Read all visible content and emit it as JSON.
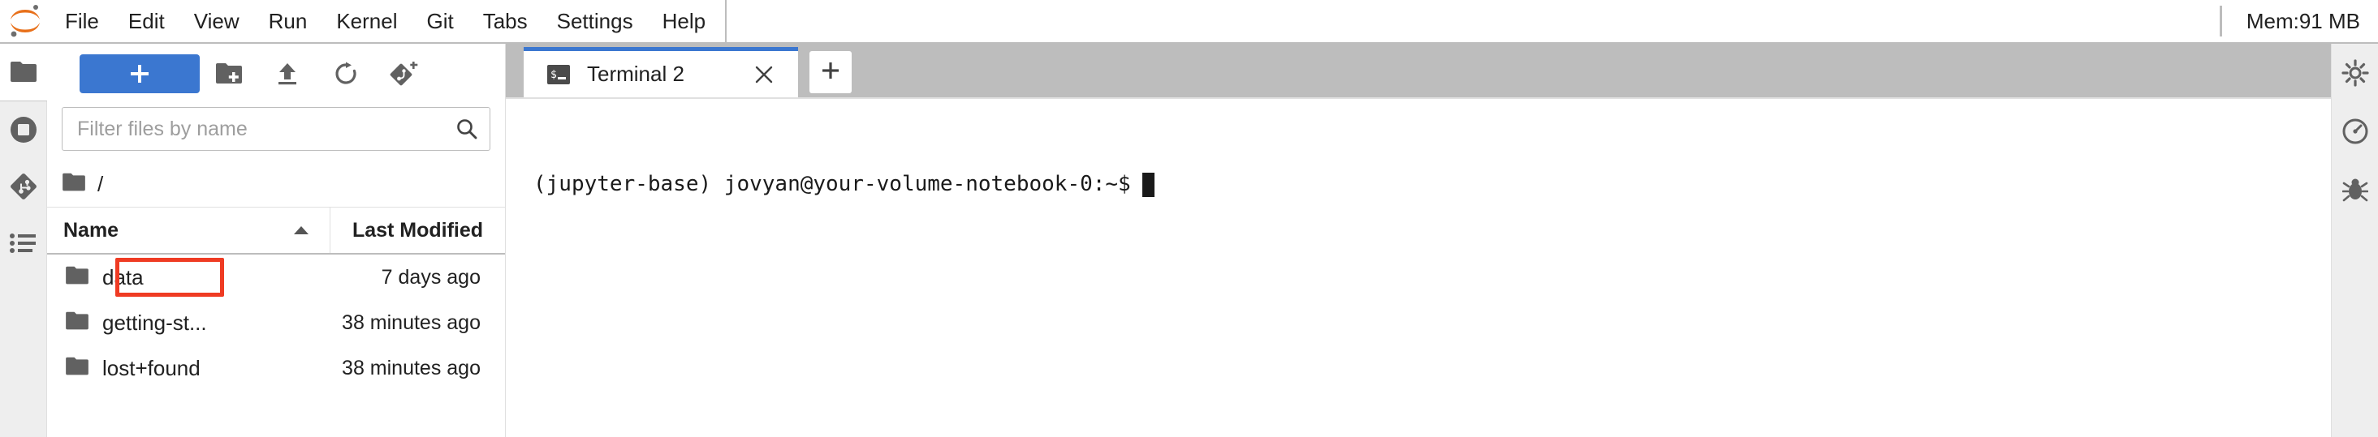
{
  "menubar": {
    "logo_name": "jupyter-logo",
    "items": [
      {
        "label": "File"
      },
      {
        "label": "Edit"
      },
      {
        "label": "View"
      },
      {
        "label": "Run"
      },
      {
        "label": "Kernel"
      },
      {
        "label": "Git"
      },
      {
        "label": "Tabs"
      },
      {
        "label": "Settings"
      },
      {
        "label": "Help"
      }
    ],
    "memory_label": "Mem:91 MB"
  },
  "left_sidebar": {
    "items": [
      {
        "name": "file-browser-icon",
        "active": true
      },
      {
        "name": "running-terminals-icon",
        "active": false
      },
      {
        "name": "git-icon",
        "active": false
      },
      {
        "name": "table-of-contents-icon",
        "active": false
      }
    ]
  },
  "right_sidebar": {
    "items": [
      {
        "name": "property-inspector-icon"
      },
      {
        "name": "kernel-usage-icon"
      },
      {
        "name": "debugger-icon"
      }
    ]
  },
  "filebrowser": {
    "toolbar": {
      "new_launcher_label": "+",
      "new_folder_icon": "new-folder-icon",
      "upload_icon": "upload-icon",
      "refresh_icon": "refresh-icon",
      "git_clone_icon": "git-clone-icon"
    },
    "filter": {
      "placeholder": "Filter files by name",
      "value": "",
      "search_icon": "search-icon"
    },
    "breadcrumb": {
      "root_icon": "folder-icon",
      "path": "/"
    },
    "columns": {
      "name": "Name",
      "last_modified": "Last Modified",
      "sort_direction": "asc"
    },
    "rows": [
      {
        "icon": "folder-icon",
        "name": "data",
        "modified": "7 days ago",
        "highlighted": true
      },
      {
        "icon": "folder-icon",
        "name": "getting-st...",
        "modified": "38 minutes ago",
        "highlighted": false
      },
      {
        "icon": "folder-icon",
        "name": "lost+found",
        "modified": "38 minutes ago",
        "highlighted": false
      }
    ],
    "highlight_color": "#ef3b23"
  },
  "dock": {
    "tabs": [
      {
        "icon": "terminal-icon",
        "label": "Terminal 2",
        "active": true,
        "close_icon": "close-icon"
      }
    ],
    "add_tab_icon": "plus-icon"
  },
  "terminal": {
    "prompt": "(jupyter-base) jovyan@your-volume-notebook-0:~$",
    "cursor": "block"
  },
  "colors": {
    "accent": "#3b77d0",
    "highlight": "#ef3b23",
    "jupyter_orange": "#e8701a",
    "chrome_gray": "#bdbdbd",
    "sidebar_gray": "#eeeeee"
  }
}
